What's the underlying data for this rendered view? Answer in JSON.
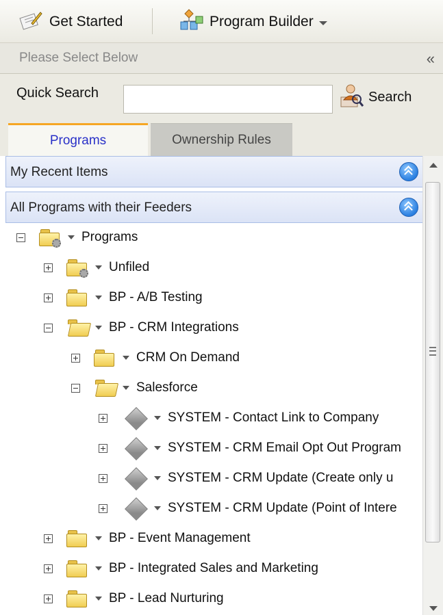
{
  "toolbar": {
    "get_started_label": "Get Started",
    "program_builder_label": "Program Builder"
  },
  "select_bar": {
    "text": "Please Select Below",
    "collapse_glyph": "«"
  },
  "search": {
    "label": "Quick Search",
    "value": "",
    "placeholder": "",
    "button_label": "Search"
  },
  "tabs": [
    {
      "label": "Programs",
      "active": true
    },
    {
      "label": "Ownership Rules",
      "active": false
    }
  ],
  "sections": {
    "recent": "My Recent Items",
    "all_programs": "All Programs with their Feeders"
  },
  "tree": [
    {
      "label": "Programs",
      "level": 0,
      "expanded": true,
      "icon": "settings-folder-icon"
    },
    {
      "label": "Unfiled",
      "level": 1,
      "expanded": false,
      "icon": "settings-folder-icon"
    },
    {
      "label": "BP - A/B Testing",
      "level": 1,
      "expanded": false,
      "icon": "folder-icon"
    },
    {
      "label": "BP - CRM Integrations",
      "level": 1,
      "expanded": true,
      "icon": "open-folder-icon"
    },
    {
      "label": "CRM On Demand",
      "level": 2,
      "expanded": false,
      "icon": "folder-icon"
    },
    {
      "label": "Salesforce",
      "level": 2,
      "expanded": true,
      "icon": "open-folder-icon"
    },
    {
      "label": "SYSTEM - Contact Link to Company",
      "level": 3,
      "expanded": false,
      "icon": "program-diamond-icon"
    },
    {
      "label": "SYSTEM - CRM Email Opt Out Program",
      "level": 3,
      "expanded": false,
      "icon": "program-diamond-icon"
    },
    {
      "label": "SYSTEM - CRM Update (Create only u",
      "level": 3,
      "expanded": false,
      "icon": "program-diamond-icon"
    },
    {
      "label": "SYSTEM - CRM Update (Point of Intere",
      "level": 3,
      "expanded": false,
      "icon": "program-diamond-icon"
    },
    {
      "label": "BP - Event Management",
      "level": 1,
      "expanded": false,
      "icon": "folder-icon"
    },
    {
      "label": "BP - Integrated Sales and Marketing",
      "level": 1,
      "expanded": false,
      "icon": "folder-icon"
    },
    {
      "label": "BP - Lead Nurturing",
      "level": 1,
      "expanded": false,
      "icon": "folder-icon"
    }
  ],
  "colors": {
    "active_tab_accent": "#f6a623",
    "active_tab_text": "#2a31c8",
    "section_header_bg": "#dbe3f6"
  }
}
